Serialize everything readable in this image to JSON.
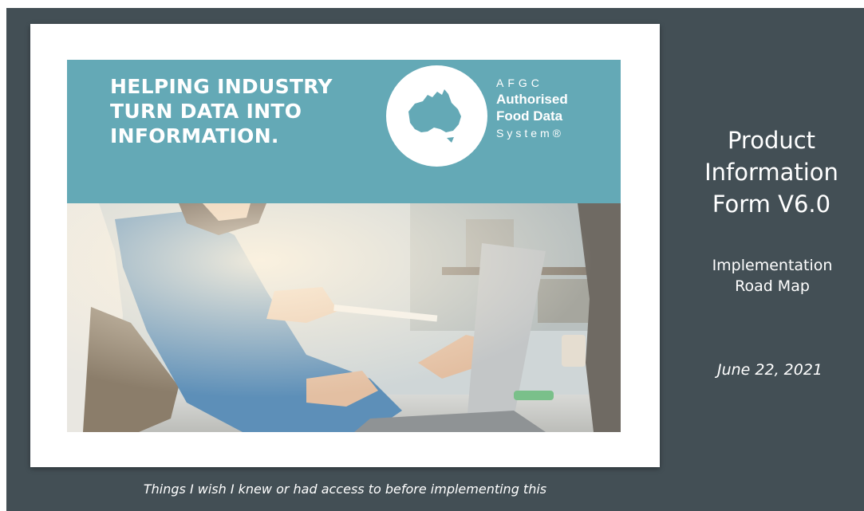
{
  "card": {
    "headline": [
      "HELPING INDUSTRY",
      "TURN DATA INTO",
      "INFORMATION."
    ],
    "logo": {
      "line1": "AFGC",
      "line2": "Authorised",
      "line3": "Food Data",
      "line4": "System®"
    }
  },
  "side": {
    "title": [
      "Product",
      "Information",
      "Form V6.0"
    ],
    "subtitle": [
      "Implementation",
      "Road Map"
    ],
    "date": "June 22, 2021"
  },
  "caption": "Things I wish I knew or had access to before implementing this",
  "colors": {
    "background": "#434f55",
    "banner": "#64a9b6",
    "card": "#ffffff",
    "text": "#ffffff"
  },
  "icons": {
    "logo": "australia-map-icon",
    "photo": "people-at-laptop-photo"
  }
}
